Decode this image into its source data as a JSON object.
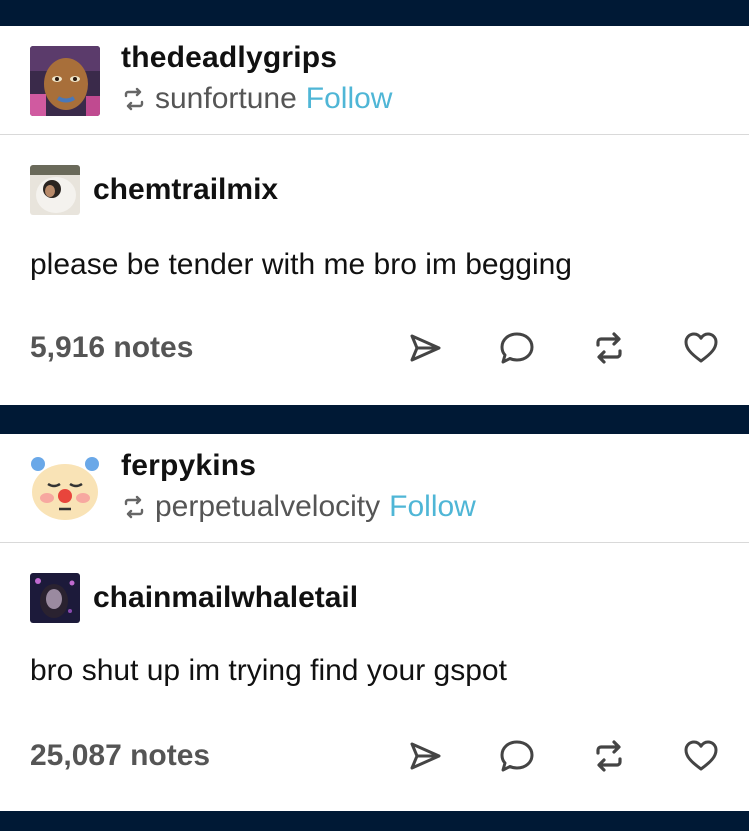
{
  "posts": [
    {
      "blog_name": "thedeadlygrips",
      "reblogged_from": "sunfortune",
      "follow_label": "Follow",
      "source_name": "chemtrailmix",
      "body": "please be tender with me bro im begging",
      "notes": "5,916 notes"
    },
    {
      "blog_name": "ferpykins",
      "reblogged_from": "perpetualvelocity",
      "follow_label": "Follow",
      "source_name": "chainmailwhaletail",
      "body": "bro shut up im trying find your gspot",
      "notes": "25,087 notes"
    }
  ],
  "colors": {
    "background": "#001935",
    "follow": "#4fb6d6",
    "icon": "#444444"
  },
  "icons": [
    "reblog-icon",
    "share-icon",
    "reply-icon",
    "reblog-icon",
    "like-icon"
  ]
}
